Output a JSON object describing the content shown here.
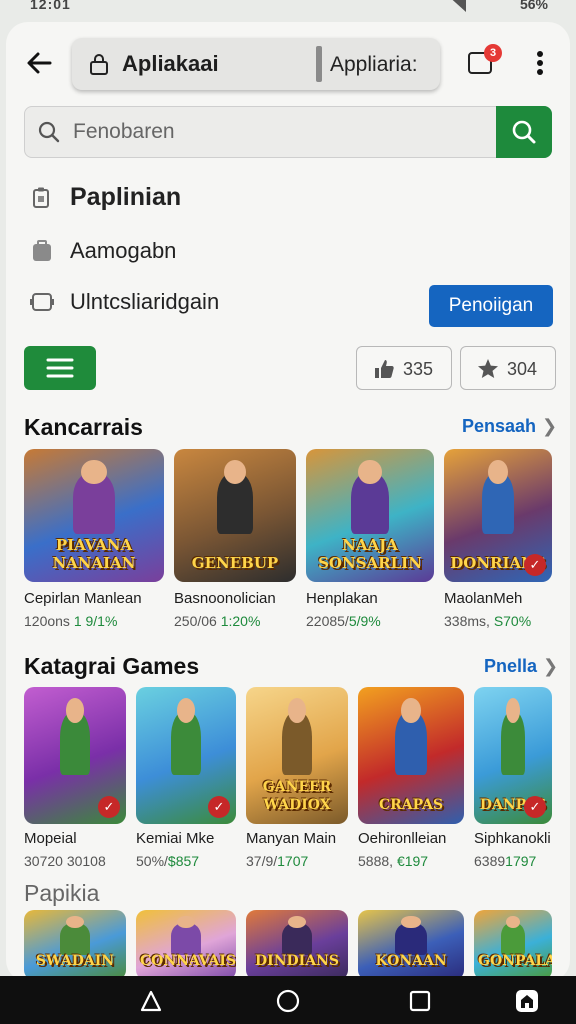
{
  "status": {
    "time": "12:01",
    "battery": "56%"
  },
  "browser": {
    "title": "Apliakaai",
    "subtitle": "Appliaria:",
    "tab_count": "3"
  },
  "search": {
    "placeholder": "Fenobaren"
  },
  "menu": {
    "item1": "Paplinian",
    "item2": "Aamogabn",
    "item3": "Ulntcsliaridgain",
    "action_button": "Penoiigan"
  },
  "filters": {
    "likes": "335",
    "stars": "304"
  },
  "section1": {
    "title": "Kancarrais",
    "link": "Pensaah",
    "apps": [
      {
        "thumb_title": "PIAVANA NANAIAN",
        "name": "Cepirlan Manlean",
        "meta_a": "120ons ",
        "meta_b": "1 9/1%",
        "colors": [
          "#3a6fc9",
          "#c77a35",
          "#7a3f9b"
        ],
        "checked": false
      },
      {
        "thumb_title": "GENEBUP",
        "name": "Basnoonolician",
        "meta_a": "250/06 ",
        "meta_b": "1:20%",
        "colors": [
          "#7a5634",
          "#c9873f",
          "#2d2d2d"
        ],
        "checked": false
      },
      {
        "thumb_title": "NAAJA SONSARLIN",
        "name": "Henplakan",
        "meta_a": "22085/",
        "meta_b": "5/9%",
        "colors": [
          "#3eb3c6",
          "#d8953a",
          "#5b3a96"
        ],
        "checked": false
      },
      {
        "thumb_title": "DONRIANS",
        "name": "MaolanMeh",
        "meta_a": "338ms, ",
        "meta_b": "S70%",
        "colors": [
          "#6a3a6b",
          "#e6a23a",
          "#2f66b5"
        ],
        "checked": true
      }
    ]
  },
  "section2": {
    "title": "Katagrai Games",
    "link": "Pnella",
    "apps": [
      {
        "thumb_title": "",
        "name": "Mopeial",
        "meta_a": "30720 30108",
        "meta_b": "",
        "colors": [
          "#7a2fa8",
          "#c25ed0",
          "#3b8a3a"
        ],
        "checked": true
      },
      {
        "thumb_title": "",
        "name": "Kemiai Mke",
        "meta_a": "50%/",
        "meta_b": "$857",
        "colors": [
          "#3d8ed8",
          "#6ad0e0",
          "#3c8b3a"
        ],
        "checked": true
      },
      {
        "thumb_title": "GANEER WADIOX",
        "name": "Manyan Main",
        "meta_a": "37/9/",
        "meta_b": "1707",
        "colors": [
          "#e2a54a",
          "#f6d58a",
          "#7b5a2a"
        ],
        "checked": false
      },
      {
        "thumb_title": "CRAPAS",
        "name": "Oehironlleian",
        "meta_a": "5888, ",
        "meta_b": "€197",
        "colors": [
          "#c22a2a",
          "#f2a020",
          "#2f5fae"
        ],
        "checked": false
      },
      {
        "thumb_title": "DANPAS",
        "name": "Siphkanokli",
        "meta_a": "6389",
        "meta_b": "1797",
        "colors": [
          "#3b9bd8",
          "#7ed3f0",
          "#3c8b3a"
        ],
        "checked": true
      }
    ]
  },
  "section3": {
    "title": "Papikia",
    "apps": [
      {
        "thumb_title": "SWADAIN",
        "colors": [
          "#4a9ad8",
          "#e8b83a",
          "#4b8b3a"
        ]
      },
      {
        "thumb_title": "CONNAVAIS",
        "colors": [
          "#e0a5d8",
          "#f0c03a",
          "#7c4aa8"
        ]
      },
      {
        "thumb_title": "DINDIANS",
        "colors": [
          "#6a3f9b",
          "#e07a3a",
          "#3a2a5a"
        ]
      },
      {
        "thumb_title": "KONAAN",
        "colors": [
          "#3c5fb8",
          "#e6c44a",
          "#2a2a7a"
        ]
      },
      {
        "thumb_title": "GONPALAS",
        "colors": [
          "#3bb0d8",
          "#f0a53a",
          "#4b9b3a"
        ]
      }
    ]
  }
}
